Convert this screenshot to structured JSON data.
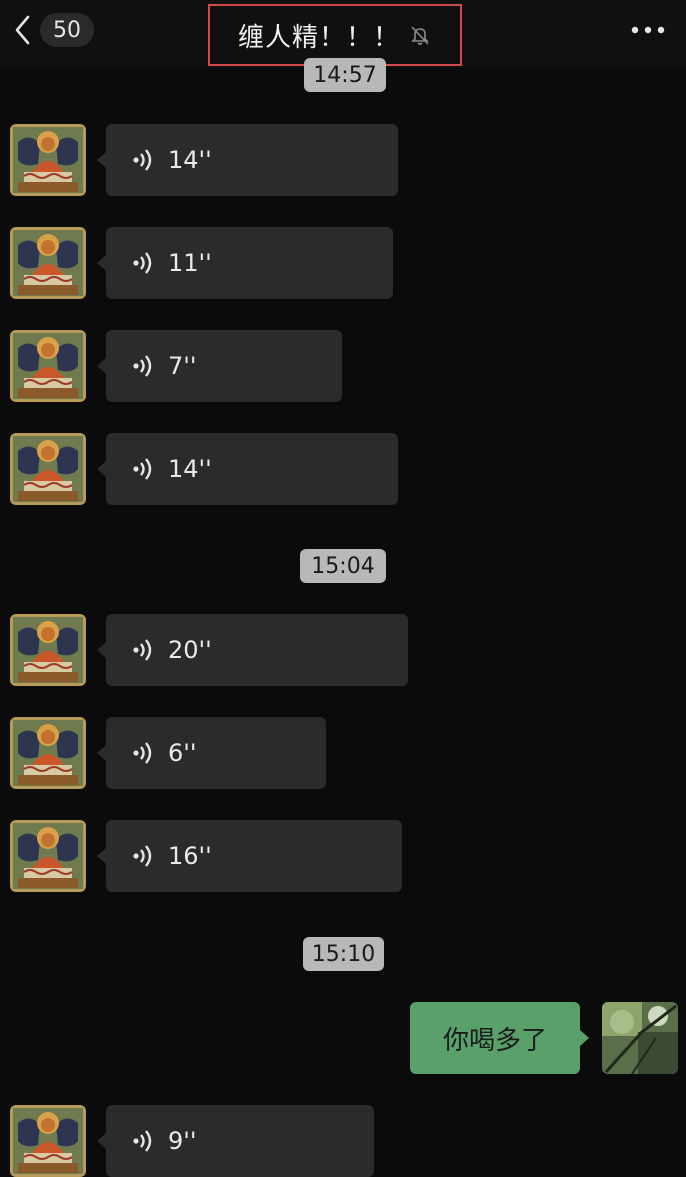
{
  "header": {
    "back_count": "50",
    "title": "缠人精！！！",
    "back_icon": "chevron-left-icon",
    "mute_icon": "bell-off-icon",
    "more_icon": "more-dots-icon"
  },
  "timestamps": [
    "14:57",
    "15:04",
    "15:10"
  ],
  "messages": [
    {
      "type": "voice",
      "direction": "in",
      "duration": "14''"
    },
    {
      "type": "voice",
      "direction": "in",
      "duration": "11''"
    },
    {
      "type": "voice",
      "direction": "in",
      "duration": "7''"
    },
    {
      "type": "voice",
      "direction": "in",
      "duration": "14''"
    },
    {
      "type": "voice",
      "direction": "in",
      "duration": "20''"
    },
    {
      "type": "voice",
      "direction": "in",
      "duration": "6''"
    },
    {
      "type": "voice",
      "direction": "in",
      "duration": "16''"
    },
    {
      "type": "text",
      "direction": "out",
      "text": "你喝多了"
    },
    {
      "type": "voice",
      "direction": "in",
      "duration": "9''"
    }
  ],
  "colors": {
    "background": "#0b0b0b",
    "incoming_bubble": "#2b2b2b",
    "outgoing_bubble": "#5aa06a",
    "timestamp_pill": "#b8b8b8",
    "title_highlight": "#d24a4a"
  }
}
